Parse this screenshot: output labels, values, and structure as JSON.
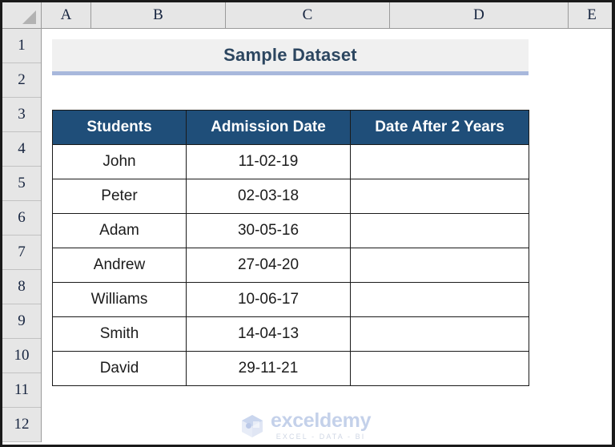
{
  "app": {
    "type": "spreadsheet",
    "select_all_icon": "select-all-triangle-icon"
  },
  "grid": {
    "columns": [
      "A",
      "B",
      "C",
      "D",
      "E"
    ],
    "rows": [
      "1",
      "2",
      "3",
      "4",
      "5",
      "6",
      "7",
      "8",
      "9",
      "10",
      "11",
      "12"
    ]
  },
  "title": {
    "text": "Sample Dataset",
    "background": "#f0f0f0",
    "underline_color": "#a8b8dc",
    "text_color": "#2c4660"
  },
  "table": {
    "header_background": "#1f4e79",
    "header_text_color": "#ffffff",
    "border_color": "#1a1a1a",
    "headers": [
      "Students",
      "Admission Date",
      "Date After 2 Years"
    ],
    "rows": [
      {
        "students": "John",
        "admission_date": "11-02-19",
        "date_after_2_years": ""
      },
      {
        "students": "Peter",
        "admission_date": "02-03-18",
        "date_after_2_years": ""
      },
      {
        "students": "Adam",
        "admission_date": "30-05-16",
        "date_after_2_years": ""
      },
      {
        "students": "Andrew",
        "admission_date": "27-04-20",
        "date_after_2_years": ""
      },
      {
        "students": "Williams",
        "admission_date": "10-06-17",
        "date_after_2_years": ""
      },
      {
        "students": "Smith",
        "admission_date": "14-04-13",
        "date_after_2_years": ""
      },
      {
        "students": "David",
        "admission_date": "29-11-21",
        "date_after_2_years": ""
      }
    ]
  },
  "watermark": {
    "name": "exceldemy",
    "tagline": "EXCEL - DATA - BI",
    "logo_icon": "exceldemy-cube-logo-icon",
    "color": "#c3d0ea"
  }
}
